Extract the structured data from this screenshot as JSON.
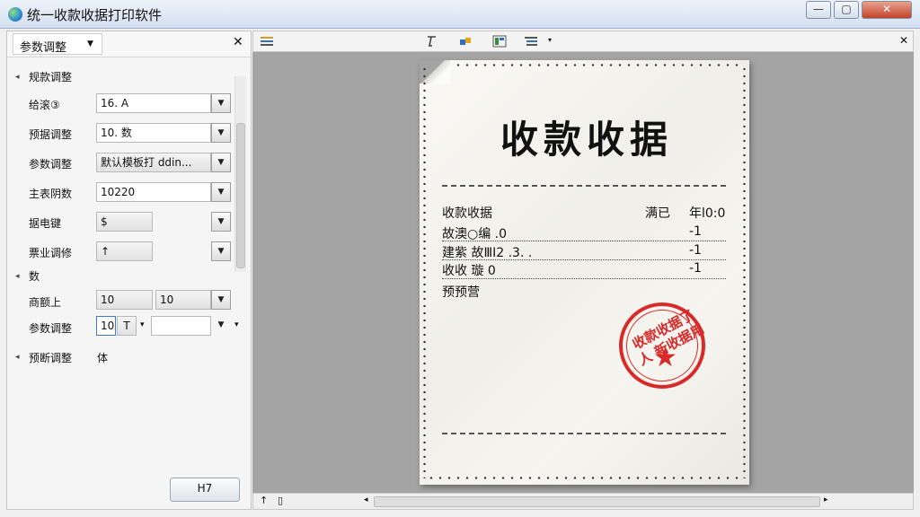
{
  "window": {
    "title": "统一收款收据打印软件",
    "minimize_glyph": "—",
    "maximize_glyph": "▢",
    "close_glyph": "✕"
  },
  "panel": {
    "title": "参数调整",
    "dropdown_glyph": "▼",
    "close_glyph": "✕",
    "section1_title": "规款调整",
    "rows": [
      {
        "label": "给滚③",
        "value": "16. A"
      },
      {
        "label": "预据调整",
        "value": "10. 数"
      },
      {
        "label": "参数调整",
        "value": "默认模板打 ddin..."
      },
      {
        "label": "主表阴数",
        "value": "10220"
      },
      {
        "label": "据电键",
        "value": "$"
      },
      {
        "label": "票业调修",
        "value": "↑"
      }
    ],
    "section2_title": "数",
    "row7": {
      "label": "商额上",
      "value1": "10",
      "value2": "10"
    },
    "row8": {
      "label": "参数调整",
      "value1": "10",
      "glyph": "T"
    },
    "section3": {
      "title": "预断调整",
      "value": "体"
    },
    "button_label": "H7",
    "dd_glyph": "▼",
    "small_dd_glyph": "▾",
    "arrow_glyph": "◂"
  },
  "toolbar": {
    "close_glyph": "✕",
    "icons": [
      "align-icon",
      "text-tool-icon",
      "colors-icon",
      "layout-icon",
      "list-icon"
    ]
  },
  "receipt": {
    "title": "收款收据",
    "header_left": "收款收据",
    "header_mid": "满已",
    "header_right": "年l0:0",
    "lines": [
      {
        "left": "故澳○编 .0",
        "right": "-1"
      },
      {
        "left": "建紫  故ⅢI2 .3. .",
        "right": "-1"
      },
      {
        "left": "收收  璇  0",
        "right": "-1"
      }
    ],
    "note": "预预营",
    "stamp_text": "收款收据了人 新收据用",
    "stamp_star": "★"
  },
  "bottombar": {
    "left_glyph1": "↑",
    "left_glyph2": "▯",
    "scroll_left": "◂",
    "scroll_right": "▸"
  }
}
